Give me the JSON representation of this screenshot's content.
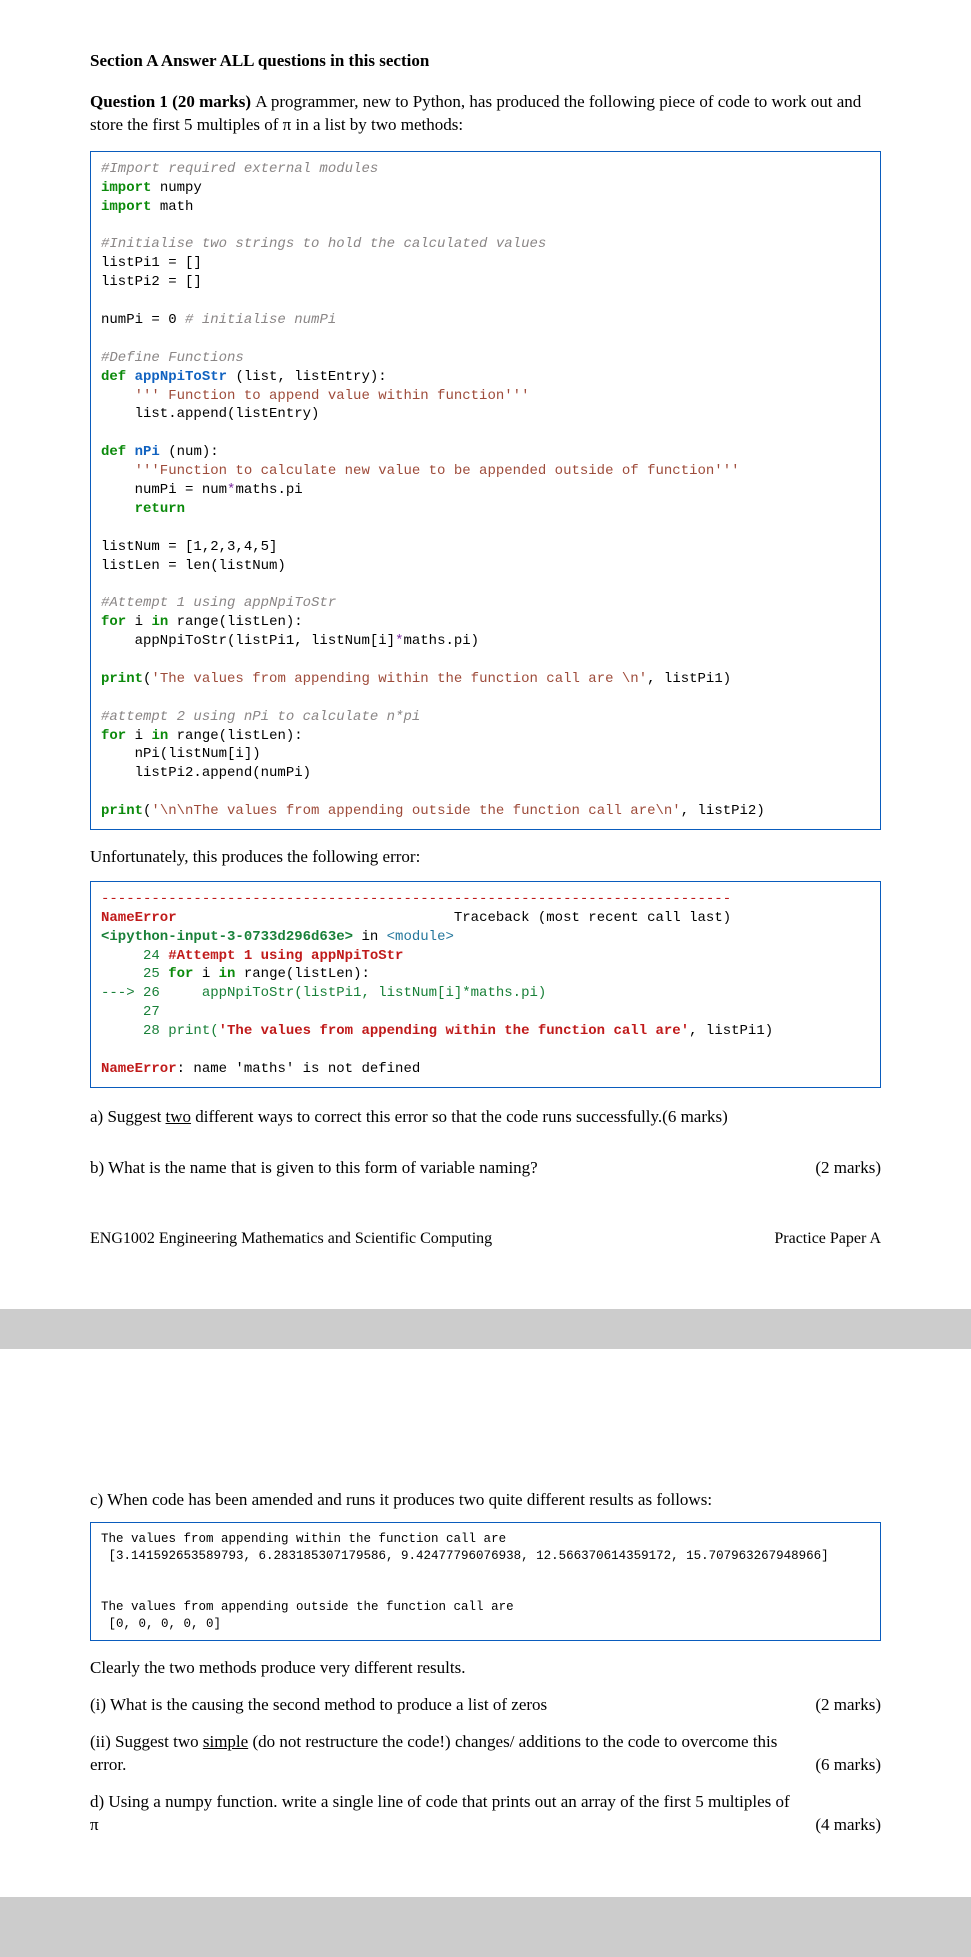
{
  "header": {
    "section_title": "Section A   Answer ALL questions in this section",
    "q1_lead": "Question 1 (20 marks) ",
    "q1_body1": "A programmer, new to Python, has produced the following piece of code to work out and store the first 5 multiples of ",
    "pi": "π",
    "q1_body2": " in a list by two methods:"
  },
  "code1": {
    "l1": "#Import required external modules",
    "l2a": "import",
    "l2b": " numpy",
    "l3a": "import",
    "l3b": " math",
    "blank1": "",
    "l4": "#Initialise two strings to hold the calculated values",
    "l5a": "listPi1 = ",
    "l5b": "[]",
    "l6a": "listPi2 = ",
    "l6b": "[]",
    "blank2": "",
    "l7a": "numPi = 0 ",
    "l7b": "# initialise numPi",
    "blank3": "",
    "l8": "#Define Functions",
    "l9a": "def",
    "l9b": " appNpiToStr ",
    "l9c": "(list, listEntry):",
    "l10": "    ''' Function to append value within function'''",
    "l11": "    list.append(listEntry)",
    "blank4": "",
    "l12a": "def",
    "l12b": " nPi ",
    "l12c": "(num):",
    "l13": "    '''Function to calculate new value to be appended outside of function'''",
    "l14a": "    numPi = num",
    "l14b": "*",
    "l14c": "maths.pi",
    "l15a": "    ",
    "l15b": "return",
    "blank5": "",
    "l16a": "listNum = ",
    "l16b": "[1,2,3,4,5]",
    "l17": "listLen = len(listNum)",
    "blank6": "",
    "l18": "#Attempt 1 using appNpiToStr",
    "l19a": "for",
    "l19b": " i ",
    "l19c": "in",
    "l19d": " range(listLen):",
    "l20a": "    appNpiToStr(listPi1, listNum[i]",
    "l20b": "*",
    "l20c": "maths.pi)",
    "blank7": "",
    "l21a": "print",
    "l21b": "(",
    "l21c": "'The values from appending within the function call are \\n'",
    "l21d": ", listPi1)",
    "blank8": "",
    "l22": "#attempt 2 using nPi to calculate n*pi",
    "l23a": "for",
    "l23b": " i ",
    "l23c": "in",
    "l23d": " range(listLen):",
    "l24": "    nPi(listNum[i])",
    "l25": "    listPi2.append(numPi)",
    "blank9": "",
    "l26a": "print",
    "l26b": "(",
    "l26c": "'\\n\\nThe values from appending outside the function call are\\n'",
    "l26d": ", listPi2)"
  },
  "mid1": "Unfortunately, this produces the following error:",
  "err": {
    "dash": "---------------------------------------------------------------------------",
    "l1a": "NameError",
    "l1b": "                                 Traceback (most recent call last)",
    "l2a": "<ipython-input-3-0733d296d63e>",
    "l2b": " in ",
    "l2c": "<module>",
    "l3a": "     24 ",
    "l3b": "#Attempt 1 using appNpiToStr",
    "l4a": "     25 ",
    "l4b": "for",
    "l4c": " i ",
    "l4d": "in",
    "l4e": " range(listLen):",
    "l5a": "---> 26     appNpiToStr(listPi1, listNum[i]*maths.pi)",
    "l6": "     27",
    "l7a": "     28 print(",
    "l7b": "'The values from appending within the function call are'",
    "l7c": ", listPi1)",
    "blank": "",
    "l8a": "NameError",
    "l8b": ": name 'maths' is not defined"
  },
  "qa": {
    "text": "a) Suggest ",
    "u": "two",
    "text2": " different ways to correct this error so that the code runs successfully.(6 marks)"
  },
  "qb": {
    "text": "b) What is the name that is given to this form of variable naming?",
    "marks": "(2 marks)"
  },
  "footer": {
    "left": "ENG1002 Engineering Mathematics and Scientific Computing",
    "right": "Practice Paper A"
  },
  "page2": {
    "qc": "c) When code has been amended and runs it produces two quite different results as follows:",
    "out": {
      "l1": "The values from appending within the function call are",
      "l2": " [3.141592653589793, 6.283185307179586, 9.42477796076938, 12.566370614359172, 15.707963267948966]",
      "blank": "",
      "blank2": "",
      "l3": "The values from appending outside the function call are",
      "l4": " [0, 0, 0, 0, 0]"
    },
    "clearly": "Clearly the two methods produce very different results.",
    "ci": {
      "text": "(i) What is the causing the second method to produce a list of zeros",
      "marks": "(2 marks)"
    },
    "cii": {
      "pre": "(ii) Suggest two ",
      "u": "simple",
      "post": " (do not restructure the code!) changes/ additions to the code to overcome this error.",
      "marks": "(6 marks)"
    },
    "qd": {
      "text1": "d)  Using a numpy function. write a single line of code that prints out an array of the first 5 multiples of ",
      "pi": "π",
      "marks": "(4 marks)"
    }
  }
}
